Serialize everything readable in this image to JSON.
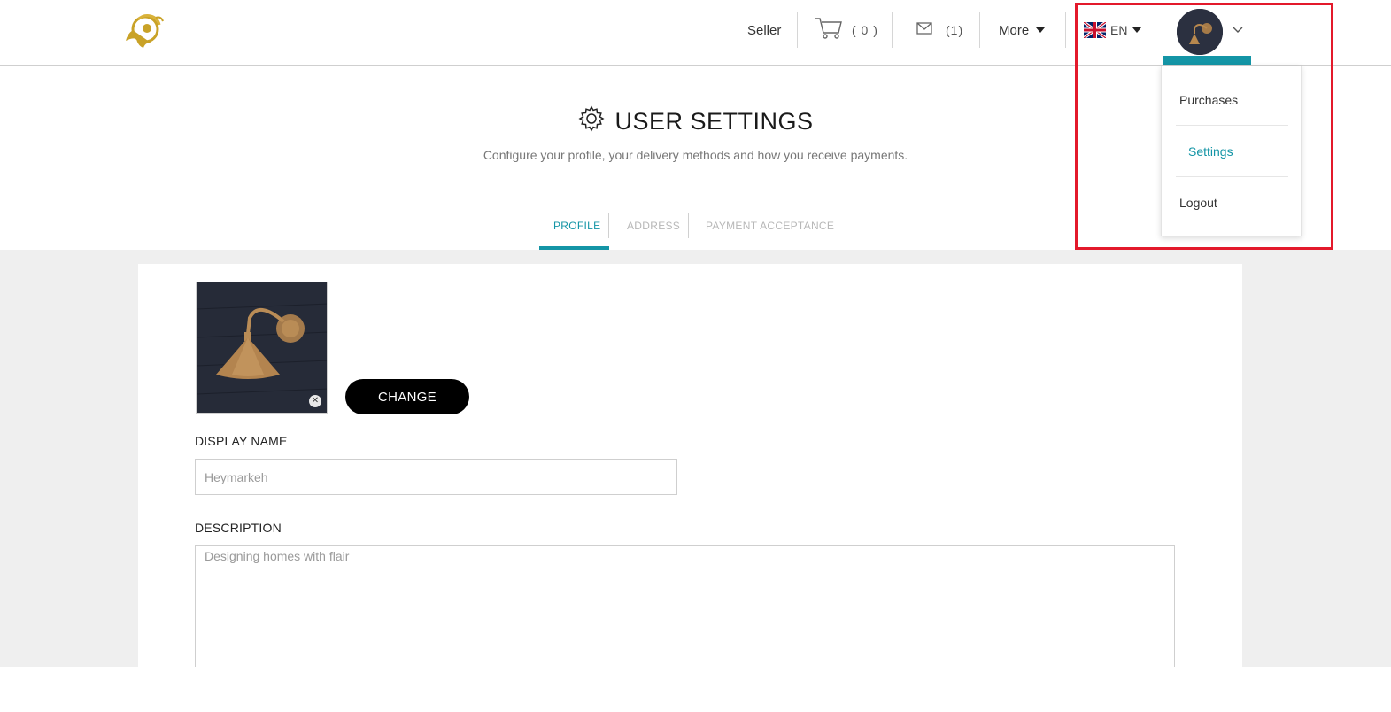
{
  "header": {
    "logo_name": "lion-logo",
    "seller_label": "Seller",
    "cart_count": "( 0 )",
    "messages_count": "(1)",
    "more_label": "More",
    "language_label": "EN",
    "accent_color": "#1495a6"
  },
  "page": {
    "title": "USER SETTINGS",
    "subtitle": "Configure your profile, your delivery methods and how you receive payments."
  },
  "tabs": [
    {
      "label": "PROFILE",
      "active": true
    },
    {
      "label": "ADDRESS",
      "active": false
    },
    {
      "label": "PAYMENT ACCEPTANCE",
      "active": false
    }
  ],
  "profile": {
    "change_label": "CHANGE",
    "display_name_label": "DISPLAY NAME",
    "display_name_placeholder": "Heymarkeh",
    "description_label": "DESCRIPTION",
    "description_placeholder": "Designing homes with flair"
  },
  "user_menu": {
    "items": [
      {
        "label": "Purchases",
        "active": false
      },
      {
        "label": "Settings",
        "active": true
      },
      {
        "label": "Logout",
        "active": false
      }
    ]
  },
  "colors": {
    "accent": "#1495a6",
    "highlight_box": "#e3192b",
    "logo_gold": "#c9a227"
  }
}
